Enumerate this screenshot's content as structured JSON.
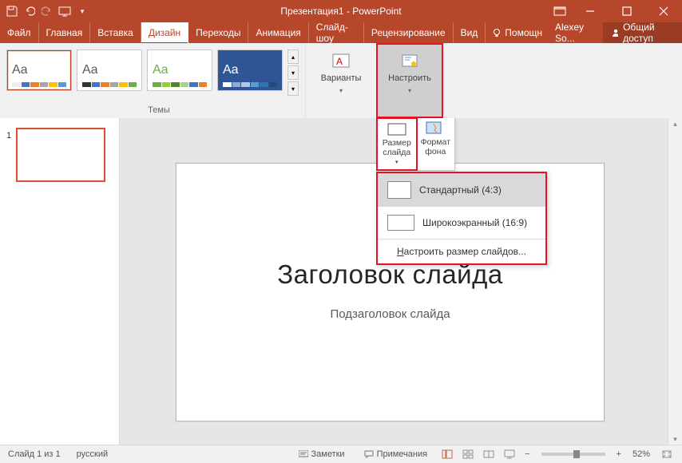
{
  "titlebar": {
    "title": "Презентация1 - PowerPoint"
  },
  "menu": {
    "tabs": [
      "Файл",
      "Главная",
      "Вставка",
      "Дизайн",
      "Переходы",
      "Анимация",
      "Слайд-шоу",
      "Рецензирование",
      "Вид"
    ],
    "active": "Дизайн",
    "assist": "Помощн",
    "user": "Alexey So...",
    "share": "Общий доступ"
  },
  "ribbon": {
    "themes_label": "Темы",
    "variants_label": "Варианты",
    "customize_label": "Настроить"
  },
  "sizepanel": {
    "slide_size": "Размер\nслайда",
    "format_bg": "Формат\nфона"
  },
  "dropdown": {
    "standard": "Стандартный (4:3)",
    "wide": "Широкоэкранный (16:9)",
    "custom": "Настроить размер слайдов..."
  },
  "slide": {
    "title": "Заголовок слайда",
    "subtitle": "Подзаголовок слайда",
    "thumb_num": "1"
  },
  "status": {
    "slide_pos": "Слайд 1 из 1",
    "lang": "русский",
    "notes": "Заметки",
    "comments": "Примечания",
    "zoom": "52%"
  },
  "colors": {
    "accent": "#B7472A",
    "highlight": "#E81123"
  }
}
